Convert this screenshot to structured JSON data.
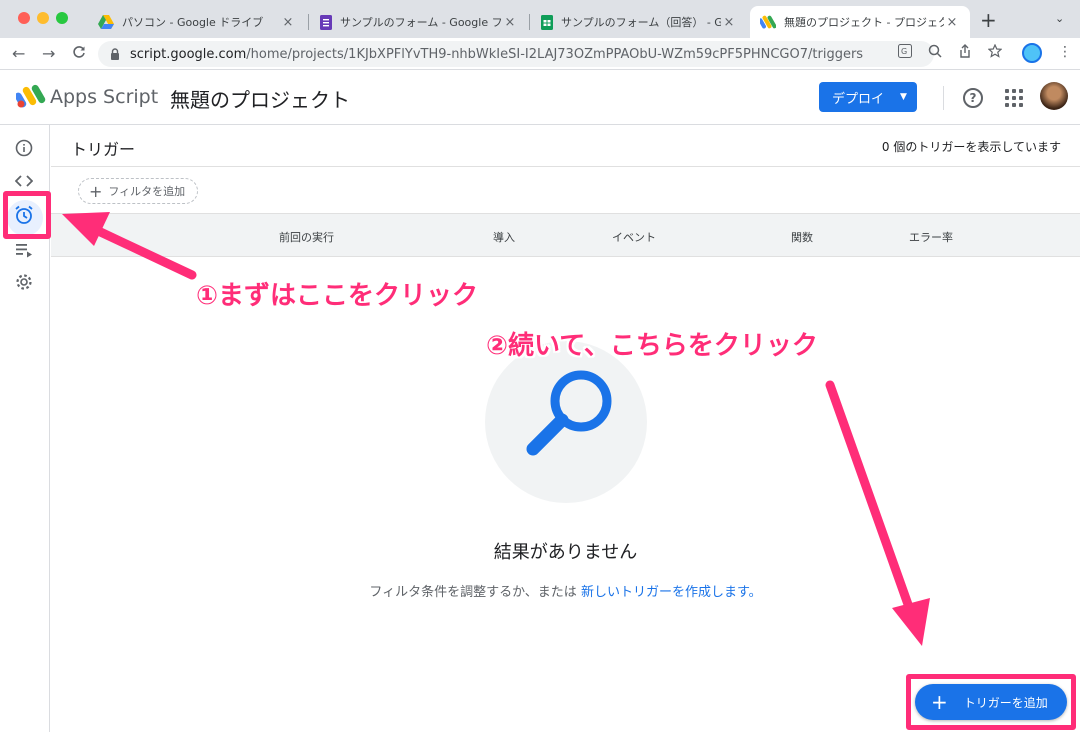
{
  "browser": {
    "tabs": [
      {
        "title": "パソコン - Google ドライブ",
        "close": "×",
        "icon": "drive-icon"
      },
      {
        "title": "サンプルのフォーム - Google フォ",
        "close": "×",
        "icon": "forms-icon"
      },
      {
        "title": "サンプルのフォーム（回答） - Go",
        "close": "×",
        "icon": "sheets-icon"
      },
      {
        "title": "無題のプロジェクト - プロジェクト",
        "close": "×",
        "icon": "apps-script-icon",
        "active": true
      }
    ],
    "new_tab": "+",
    "tab_menu": "⌄",
    "back": "←",
    "forward": "→",
    "reload": "C",
    "url_host": "script.google.com",
    "url_path": "/home/projects/1KJbXPFlYvTH9-nhbWkIeSI-I2LAJ73OZmPPAObU-WZm59cPF5PHNCGO7/triggers",
    "kebab": "⋮"
  },
  "app": {
    "brand": "Apps Script",
    "project_title": "無題のプロジェクト",
    "deploy_label": "デプロイ",
    "deploy_caret": "▼",
    "help": "?"
  },
  "rail": {
    "items": [
      {
        "icon": "info-icon"
      },
      {
        "icon": "code-icon"
      },
      {
        "icon": "alarm-clock-icon",
        "active": true
      },
      {
        "icon": "executions-icon"
      },
      {
        "icon": "gear-icon"
      }
    ]
  },
  "main": {
    "heading": "トリガー",
    "count_text": "0 個のトリガーを表示しています",
    "filter_plus": "+",
    "filter_label": "フィルタを追加",
    "columns": [
      "前回の実行",
      "導入",
      "イベント",
      "関数",
      "エラー率"
    ],
    "empty_title": "結果がありません",
    "empty_desc": "フィルタ条件を調整するか、または",
    "empty_link": "新しいトリガーを作成します。",
    "add_plus": "+",
    "add_trigger_label": "トリガーを追加"
  },
  "annotations": {
    "step1": "①まずはここをクリック",
    "step2": "②続いて、こちらをクリック",
    "color": "#ff2d78"
  },
  "colors": {
    "accent": "#1a73e8",
    "highlight": "#ff2d78"
  }
}
